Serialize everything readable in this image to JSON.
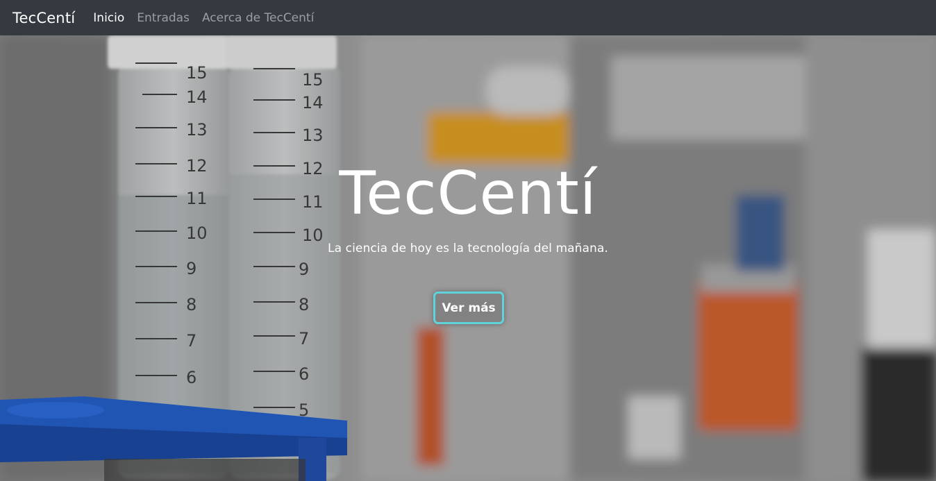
{
  "navbar": {
    "brand": "TecCentí",
    "links": [
      {
        "label": "Inicio",
        "active": true
      },
      {
        "label": "Entradas",
        "active": false
      },
      {
        "label": "Acerca de TecCentí",
        "active": false
      }
    ]
  },
  "hero": {
    "title": "TecCentí",
    "subtitle": "La ciencia de hoy es la tecnología del mañana.",
    "button_label": "Ver más",
    "button_border_color": "#5fd3dc"
  },
  "colors": {
    "navbar_bg": "#343a40",
    "rack_blue": "#1f5fd1",
    "liquid_orange": "#e0602a",
    "cap_yellow": "#f2a81c"
  }
}
